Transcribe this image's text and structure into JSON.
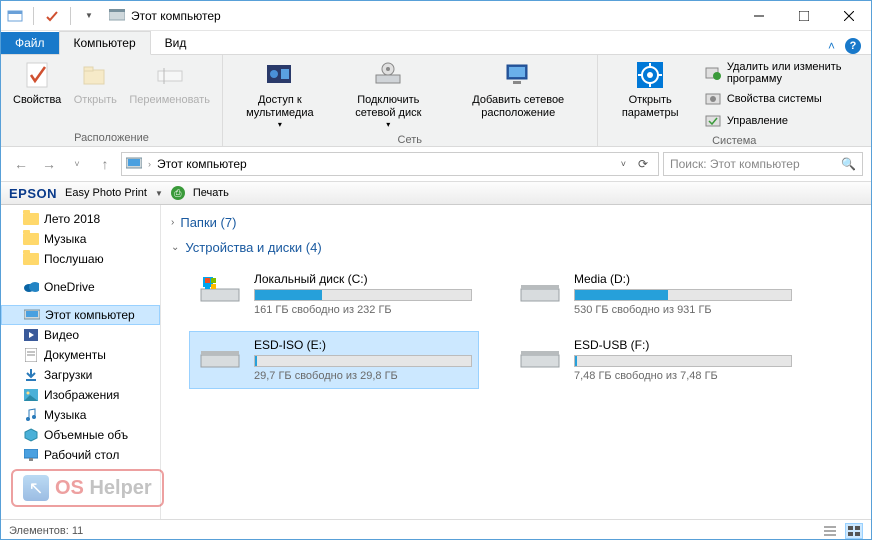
{
  "title": "Этот компьютер",
  "tabs": {
    "file": "Файл",
    "computer": "Компьютер",
    "view": "Вид"
  },
  "ribbon": {
    "location": {
      "label": "Расположение",
      "properties": "Свойства",
      "open": "Открыть",
      "rename": "Переименовать"
    },
    "network": {
      "label": "Сеть",
      "media": "Доступ к мультимедиа",
      "mapdrive": "Подключить сетевой диск",
      "addloc": "Добавить сетевое расположение"
    },
    "system": {
      "label": "Система",
      "settings": "Открыть параметры",
      "uninstall": "Удалить или изменить программу",
      "sysprops": "Свойства системы",
      "manage": "Управление"
    }
  },
  "address": {
    "path": "Этот компьютер"
  },
  "search": {
    "placeholder": "Поиск: Этот компьютер"
  },
  "epson": {
    "brand": "EPSON",
    "app": "Easy Photo Print",
    "print": "Печать"
  },
  "sidebar": {
    "items": [
      {
        "label": "Лето 2018"
      },
      {
        "label": "Музыка"
      },
      {
        "label": "Послушаю"
      },
      {
        "label": "OneDrive"
      },
      {
        "label": "Этот компьютер"
      },
      {
        "label": "Видео"
      },
      {
        "label": "Документы"
      },
      {
        "label": "Загрузки"
      },
      {
        "label": "Изображения"
      },
      {
        "label": "Музыка"
      },
      {
        "label": "Объемные объ"
      },
      {
        "label": "Рабочий стол"
      }
    ]
  },
  "groups": {
    "folders": {
      "label": "Папки (7)"
    },
    "drives": {
      "label": "Устройства и диски (4)"
    }
  },
  "drives": [
    {
      "name": "Локальный диск (C:)",
      "free": "161 ГБ свободно из 232 ГБ",
      "pct": 31
    },
    {
      "name": "Media (D:)",
      "free": "530 ГБ свободно из 931 ГБ",
      "pct": 43
    },
    {
      "name": "ESD-ISO (E:)",
      "free": "29,7 ГБ свободно из 29,8 ГБ",
      "pct": 1
    },
    {
      "name": "ESD-USB (F:)",
      "free": "7,48 ГБ свободно из 7,48 ГБ",
      "pct": 1
    }
  ],
  "status": {
    "count": "Элементов: 11"
  },
  "watermark": {
    "os": "OS",
    "helper": "Helper"
  }
}
